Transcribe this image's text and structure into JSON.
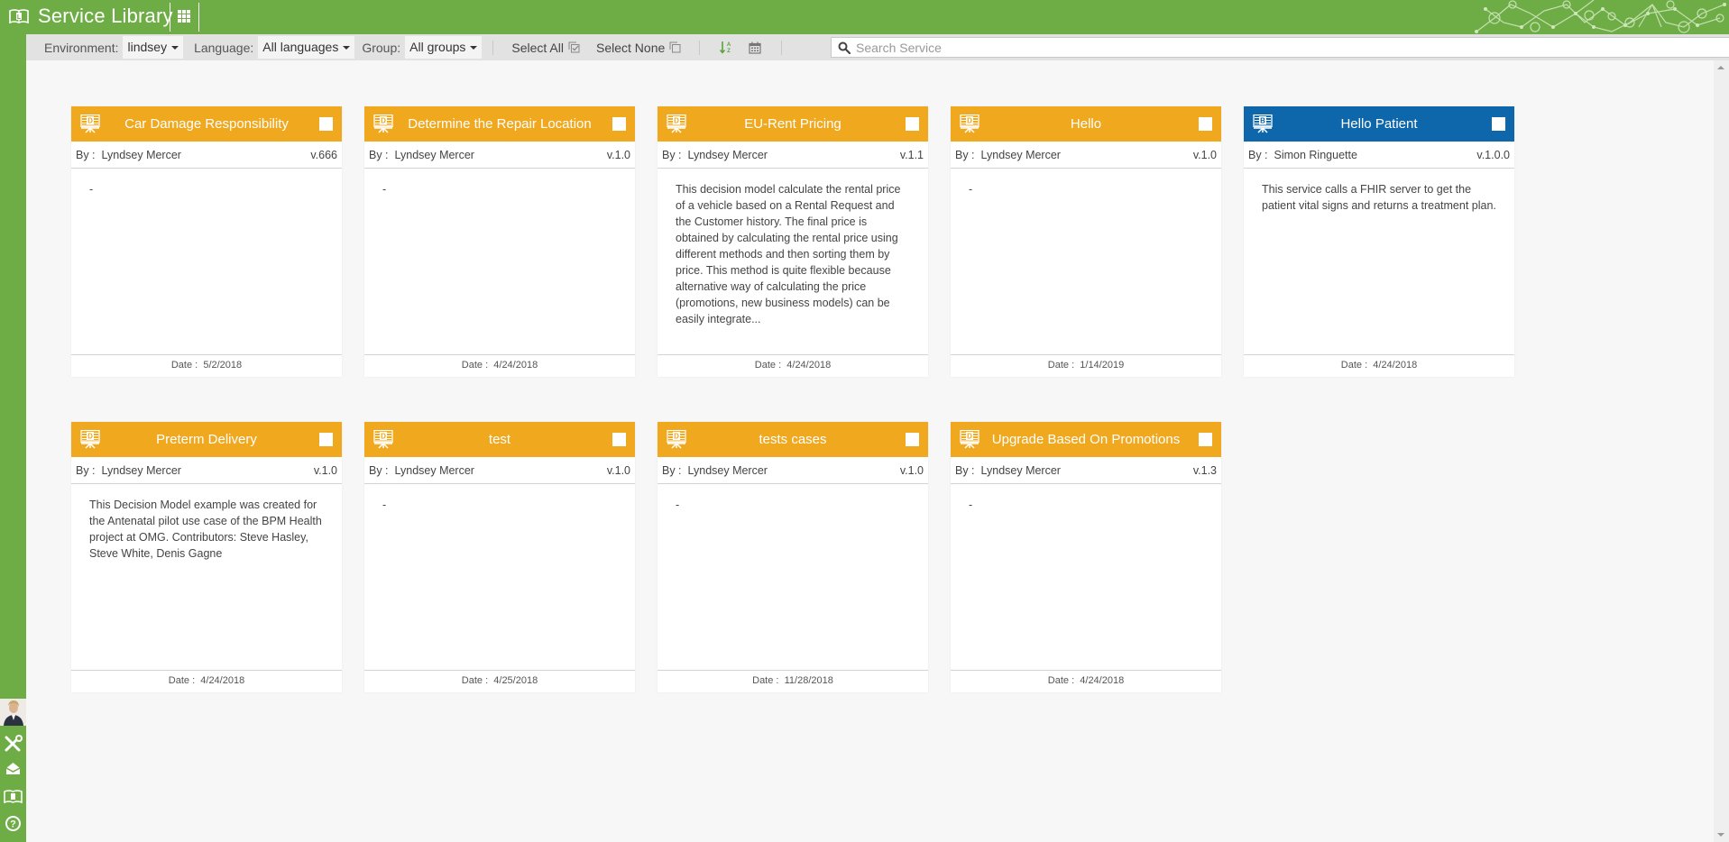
{
  "app": {
    "title": "Service Library",
    "brand_color": "#6ead45"
  },
  "toolbar": {
    "environment_label": "Environment:",
    "environment_value": "lindsey",
    "language_label": "Language:",
    "language_value": "All languages",
    "group_label": "Group:",
    "group_value": "All groups",
    "select_all_label": "Select All",
    "select_none_label": "Select None",
    "sort_icon": "sort-alpha-icon",
    "date_icon": "calendar-icon",
    "search_placeholder": "Search Service",
    "search_value": ""
  },
  "sidebar": {
    "items": [
      {
        "name": "avatar"
      },
      {
        "name": "tools-icon"
      },
      {
        "name": "inbox-icon"
      },
      {
        "name": "library-icon"
      },
      {
        "name": "help-icon"
      }
    ]
  },
  "colors": {
    "decision_header": "#f0a81e",
    "business_header": "#0e67ab"
  },
  "cards": [
    {
      "title": "Car Damage Responsibility",
      "type_letter": "D",
      "kind": "decision",
      "author_label": "By :",
      "author": "Lyndsey Mercer",
      "version": "v.666",
      "description": "-",
      "date_label": "Date :",
      "date": "5/2/2018"
    },
    {
      "title": "Determine the Repair Location",
      "type_letter": "D",
      "kind": "decision",
      "author_label": "By :",
      "author": "Lyndsey Mercer",
      "version": "v.1.0",
      "description": "-",
      "date_label": "Date :",
      "date": "4/24/2018"
    },
    {
      "title": "EU-Rent Pricing",
      "type_letter": "D",
      "kind": "decision",
      "author_label": "By :",
      "author": "Lyndsey Mercer",
      "version": "v.1.1",
      "description": "This decision model calculate the rental price of a vehicle based on a Rental Request and the Customer history.  The final price is obtained by calculating the rental price using different methods and then sorting them by price. This method is quite flexible because alternative way of calculating the price (promotions, new business models) can be easily integrate...",
      "date_label": "Date :",
      "date": "4/24/2018"
    },
    {
      "title": "Hello",
      "type_letter": "D",
      "kind": "decision",
      "author_label": "By :",
      "author": "Lyndsey Mercer",
      "version": "v.1.0",
      "description": "-",
      "date_label": "Date :",
      "date": "1/14/2019"
    },
    {
      "title": "Hello Patient",
      "type_letter": "B",
      "kind": "business",
      "author_label": "By :",
      "author": "Simon Ringuette",
      "version": "v.1.0.0",
      "description": "This service calls a FHIR server to get the patient vital signs and returns a treatment plan.",
      "date_label": "Date :",
      "date": "4/24/2018"
    },
    {
      "title": "Preterm Delivery",
      "type_letter": "D",
      "kind": "decision",
      "author_label": "By :",
      "author": "Lyndsey Mercer",
      "version": "v.1.0",
      "description": "This Decision Model example was created for the Antenatal pilot use case of the BPM Health project at OMG. Contributors: Steve Hasley, Steve White, Denis Gagne",
      "date_label": "Date :",
      "date": "4/24/2018"
    },
    {
      "title": "test",
      "type_letter": "D",
      "kind": "decision",
      "author_label": "By :",
      "author": "Lyndsey Mercer",
      "version": "v.1.0",
      "description": "-",
      "date_label": "Date :",
      "date": "4/25/2018"
    },
    {
      "title": "tests cases",
      "type_letter": "D",
      "kind": "decision",
      "author_label": "By :",
      "author": "Lyndsey Mercer",
      "version": "v.1.0",
      "description": "-",
      "date_label": "Date :",
      "date": "11/28/2018"
    },
    {
      "title": "Upgrade Based On Promotions",
      "type_letter": "D",
      "kind": "decision",
      "author_label": "By :",
      "author": "Lyndsey Mercer",
      "version": "v.1.3",
      "description": "-",
      "date_label": "Date :",
      "date": "4/24/2018"
    }
  ]
}
